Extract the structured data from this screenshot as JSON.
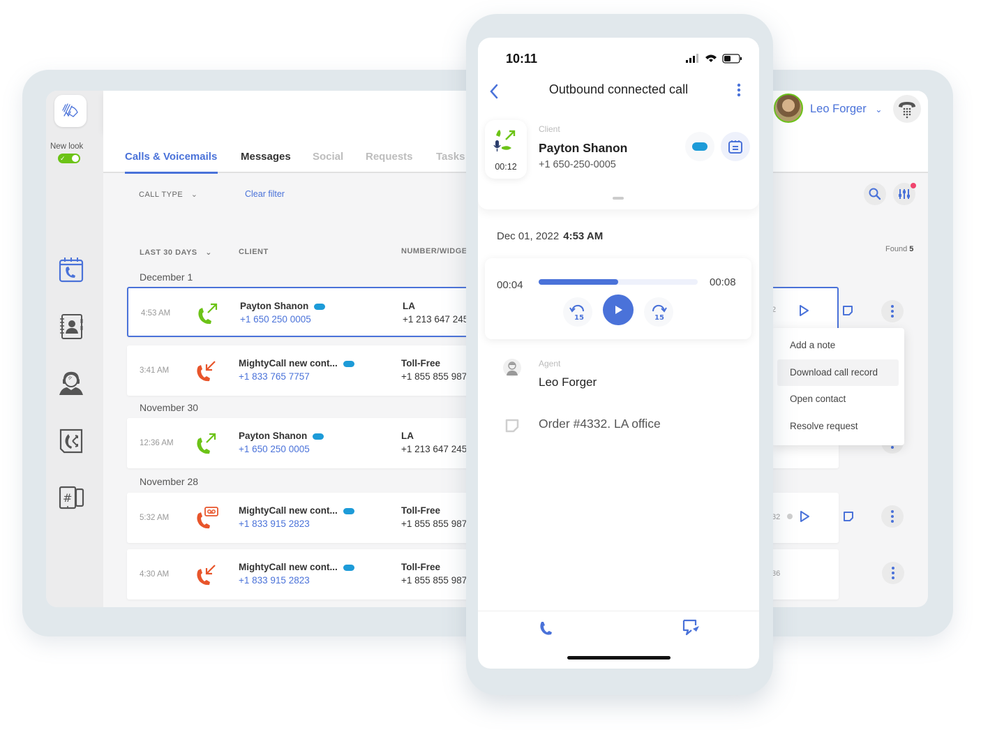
{
  "desktop": {
    "sidebar": {
      "new_look_label": "New look",
      "new_look_enabled": true,
      "nav_icons": [
        "calls-calendar-icon",
        "contacts-book-icon",
        "agent-headset-icon",
        "call-routing-icon",
        "business-numbers-icon"
      ]
    },
    "tabs": [
      {
        "label": "Calls & Voicemails",
        "active": true
      },
      {
        "label": "Messages",
        "active": false
      },
      {
        "label": "Social",
        "active": false
      },
      {
        "label": "Requests",
        "active": false
      },
      {
        "label": "Tasks",
        "active": false
      }
    ],
    "filters": {
      "call_type_label": "CALL TYPE",
      "clear_filter_label": "Clear filter"
    },
    "columns": {
      "period": "LAST 30 DAYS",
      "client": "CLIENT",
      "number": "NUMBER/WIDGE"
    },
    "groups": [
      {
        "date": "December 1",
        "rows": [
          {
            "time": "4:53 AM",
            "type": "outbound",
            "name": "Payton Shanon",
            "phone": "+1 650 250 0005",
            "number_name": "LA",
            "number": "+1 213 647 245",
            "trail": "2",
            "selected": true
          },
          {
            "time": "3:41 AM",
            "type": "missed",
            "name": "MightyCall new cont...",
            "phone": "+1 833 765 7757",
            "number_name": "Toll-Free",
            "number": "+1 855 855 987",
            "selected": false
          }
        ]
      },
      {
        "date": "November 30",
        "rows": [
          {
            "time": "12:36 AM",
            "type": "outbound",
            "name": "Payton Shanon",
            "phone": "+1 650 250 0005",
            "number_name": "LA",
            "number": "+1 213 647 245",
            "selected": false
          }
        ]
      },
      {
        "date": "November 28",
        "rows": [
          {
            "time": "5:32 AM",
            "type": "voicemail",
            "name": "MightyCall new cont...",
            "phone": "+1 833 915 2823",
            "number_name": "Toll-Free",
            "number": "+1 855 855 987",
            "trail": "32",
            "selected": false
          },
          {
            "time": "4:30 AM",
            "type": "missed",
            "name": "MightyCall new cont...",
            "phone": "+1 833 915 2823",
            "number_name": "Toll-Free",
            "number": "+1 855 855 987",
            "trail": "36",
            "selected": false
          }
        ]
      }
    ],
    "user": {
      "name": "Leo Forger"
    },
    "found_label": "Found",
    "found_count": "5",
    "context_menu": [
      {
        "label": "Add a note",
        "hover": false
      },
      {
        "label": "Download call record",
        "hover": true
      },
      {
        "label": "Open contact",
        "hover": false
      },
      {
        "label": "Resolve request",
        "hover": false
      }
    ],
    "colors": {
      "accent": "#4a72d9",
      "outbound": "#6cc317",
      "missed": "#e8552b",
      "salesforce": "#1d9bd8",
      "notification_dot": "#f0456e"
    }
  },
  "phone": {
    "status_time": "10:11",
    "title": "Outbound connected call",
    "call_duration": "00:12",
    "client_label": "Client",
    "client_name": "Payton Shanon",
    "client_phone": "+1 650-250-0005",
    "date": "Dec 01, 2022",
    "time": "4:53 AM",
    "player": {
      "current": "00:04",
      "total": "00:08",
      "progress": 0.5,
      "skip_back": "15",
      "skip_forward": "15"
    },
    "agent_label": "Agent",
    "agent_name": "Leo Forger",
    "note": "Order #4332. LA office"
  }
}
